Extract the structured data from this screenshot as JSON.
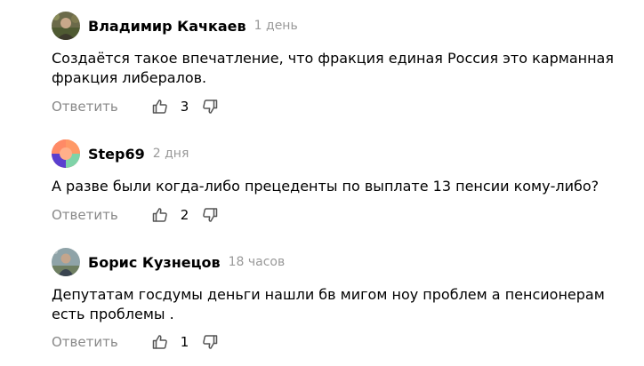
{
  "comments": [
    {
      "author": "Владимир Качкаев",
      "time": "1 день",
      "text_lines": [
        "Создаётся такое впечатление, что фракция единая Россия это карманная",
        "фракция либералов."
      ],
      "reply_label": "Ответить",
      "likes": "3"
    },
    {
      "author": "Step69",
      "time": "2 дня",
      "text_lines": [
        "А разве были когда-либо прецеденты по выплате 13 пенсии кому-либо?"
      ],
      "reply_label": "Ответить",
      "likes": "2"
    },
    {
      "author": "Борис Кузнецов",
      "time": "18 часов",
      "text_lines": [
        "Депутатам госдумы деньги нашли бв мигом ноу проблем а пенсионерам",
        "есть проблемы ."
      ],
      "reply_label": "Ответить",
      "likes": "1"
    }
  ],
  "icons": {
    "like": "thumbs-up-icon",
    "dislike": "thumbs-down-icon"
  },
  "colors": {
    "muted": "#999999",
    "text": "#000000",
    "action": "#888888"
  }
}
